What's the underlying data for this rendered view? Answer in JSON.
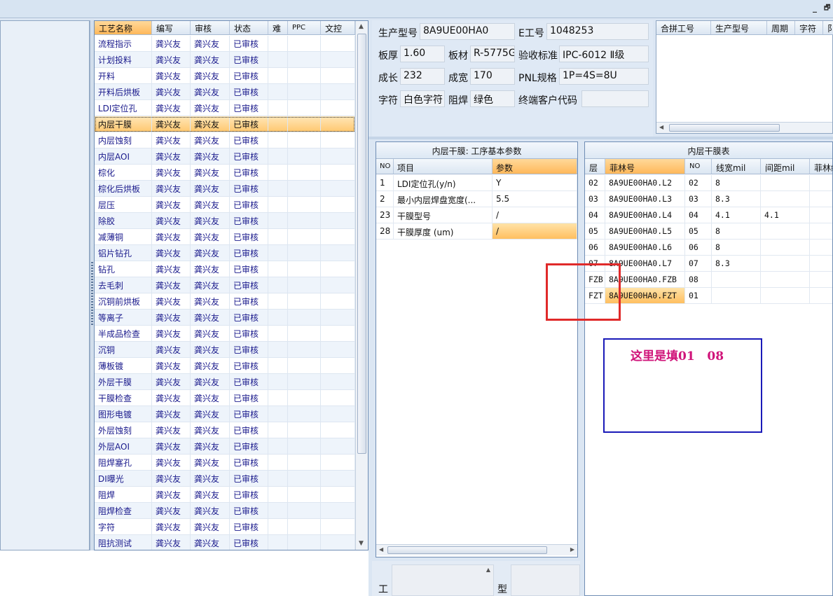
{
  "window": {
    "minimize_glyph": "_",
    "restore_glyph": "🗗"
  },
  "process_grid": {
    "headers": [
      "工艺名称",
      "编写",
      "审核",
      "状态",
      "难",
      "PPC",
      "文控"
    ],
    "rows": [
      [
        "流程指示",
        "龚兴友",
        "龚兴友",
        "已审核"
      ],
      [
        "计划投料",
        "龚兴友",
        "龚兴友",
        "已审核"
      ],
      [
        "开料",
        "龚兴友",
        "龚兴友",
        "已审核"
      ],
      [
        "开料后烘板",
        "龚兴友",
        "龚兴友",
        "已审核"
      ],
      [
        "LDI定位孔",
        "龚兴友",
        "龚兴友",
        "已审核"
      ],
      [
        "内层干膜",
        "龚兴友",
        "龚兴友",
        "已审核"
      ],
      [
        "内层蚀刻",
        "龚兴友",
        "龚兴友",
        "已审核"
      ],
      [
        "内层AOI",
        "龚兴友",
        "龚兴友",
        "已审核"
      ],
      [
        "棕化",
        "龚兴友",
        "龚兴友",
        "已审核"
      ],
      [
        "棕化后烘板",
        "龚兴友",
        "龚兴友",
        "已审核"
      ],
      [
        "层压",
        "龚兴友",
        "龚兴友",
        "已审核"
      ],
      [
        "除胶",
        "龚兴友",
        "龚兴友",
        "已审核"
      ],
      [
        "减薄铜",
        "龚兴友",
        "龚兴友",
        "已审核"
      ],
      [
        "铝片钻孔",
        "龚兴友",
        "龚兴友",
        "已审核"
      ],
      [
        "钻孔",
        "龚兴友",
        "龚兴友",
        "已审核"
      ],
      [
        "去毛刺",
        "龚兴友",
        "龚兴友",
        "已审核"
      ],
      [
        "沉铜前烘板",
        "龚兴友",
        "龚兴友",
        "已审核"
      ],
      [
        "等离子",
        "龚兴友",
        "龚兴友",
        "已审核"
      ],
      [
        "半成品检查",
        "龚兴友",
        "龚兴友",
        "已审核"
      ],
      [
        "沉铜",
        "龚兴友",
        "龚兴友",
        "已审核"
      ],
      [
        "薄板镀",
        "龚兴友",
        "龚兴友",
        "已审核"
      ],
      [
        "外层干膜",
        "龚兴友",
        "龚兴友",
        "已审核"
      ],
      [
        "干膜检查",
        "龚兴友",
        "龚兴友",
        "已审核"
      ],
      [
        "图形电镀",
        "龚兴友",
        "龚兴友",
        "已审核"
      ],
      [
        "外层蚀刻",
        "龚兴友",
        "龚兴友",
        "已审核"
      ],
      [
        "外层AOI",
        "龚兴友",
        "龚兴友",
        "已审核"
      ],
      [
        "阻焊塞孔",
        "龚兴友",
        "龚兴友",
        "已审核"
      ],
      [
        "DI曝光",
        "龚兴友",
        "龚兴友",
        "已审核"
      ],
      [
        "阻焊",
        "龚兴友",
        "龚兴友",
        "已审核"
      ],
      [
        "阻焊检查",
        "龚兴友",
        "龚兴友",
        "已审核"
      ],
      [
        "字符",
        "龚兴友",
        "龚兴友",
        "已审核"
      ],
      [
        "阻抗测试",
        "龚兴友",
        "龚兴友",
        "已审核"
      ]
    ],
    "selected_index": 5
  },
  "info": {
    "model_label": "生产型号",
    "model_value": "8A9UE00HA0",
    "eno_label": "E工号",
    "eno_value": "1048253",
    "thickness_label": "板厚",
    "thickness_value": "1.60",
    "material_label": "板材",
    "material_value": "R-5775G",
    "standard_label": "验收标准",
    "standard_value": "IPC-6012 Ⅱ级",
    "length_label": "成长",
    "length_value": "232",
    "width_label": "成宽",
    "width_value": "170",
    "pnl_label": "PNL规格",
    "pnl_value": "1P=4S=8U",
    "char_label": "字符",
    "char_value": "白色字符",
    "mask_label": "阻焊",
    "mask_value": "绿色",
    "customer_label": "终端客户代码",
    "customer_value": ""
  },
  "merge_table": {
    "headers": [
      "合拼工号",
      "生产型号",
      "周期",
      "字符",
      "阝"
    ]
  },
  "params_panel": {
    "title": "内层干膜: 工序基本参数",
    "headers": [
      "NO",
      "项目",
      "参数"
    ],
    "rows": [
      [
        "1",
        "LDI定位孔(y/n)",
        "Y"
      ],
      [
        "2",
        "最小内层焊盘宽度(...",
        "5.5"
      ],
      [
        "23",
        "干膜型号",
        "/"
      ],
      [
        "28",
        "干膜厚度 (um)",
        "/"
      ]
    ]
  },
  "film_table": {
    "title": "内层干膜表",
    "headers": [
      "层",
      "菲林号",
      "NO",
      "线宽mil",
      "间距mil",
      "菲林编"
    ],
    "rows": [
      [
        "02",
        "8A9UE00HA0.L2",
        "02",
        "8",
        ""
      ],
      [
        "03",
        "8A9UE00HA0.L3",
        "03",
        "8.3",
        ""
      ],
      [
        "04",
        "8A9UE00HA0.L4",
        "04",
        "4.1",
        "4.1"
      ],
      [
        "05",
        "8A9UE00HA0.L5",
        "05",
        "8",
        ""
      ],
      [
        "06",
        "8A9UE00HA0.L6",
        "06",
        "8",
        ""
      ],
      [
        "07",
        "8A9UE00HA0.L7",
        "07",
        "8.3",
        ""
      ],
      [
        "FZB",
        "8A9UE00HA0.FZB",
        "08",
        "",
        ""
      ],
      [
        "FZT",
        "8A9UE00HA0.FZT",
        "01",
        "",
        ""
      ]
    ]
  },
  "annotation": {
    "note_text": "这里是填01   08",
    "box_color": "#e02a2a",
    "note_border": "#1a1ab8",
    "note_text_color": "#d0147a"
  },
  "bottom": {
    "label_a": "工",
    "label_b": "型"
  },
  "colors": {
    "selection": "#ffc870",
    "grid_text": "#1a1a8c",
    "background": "#dbe6f3"
  }
}
